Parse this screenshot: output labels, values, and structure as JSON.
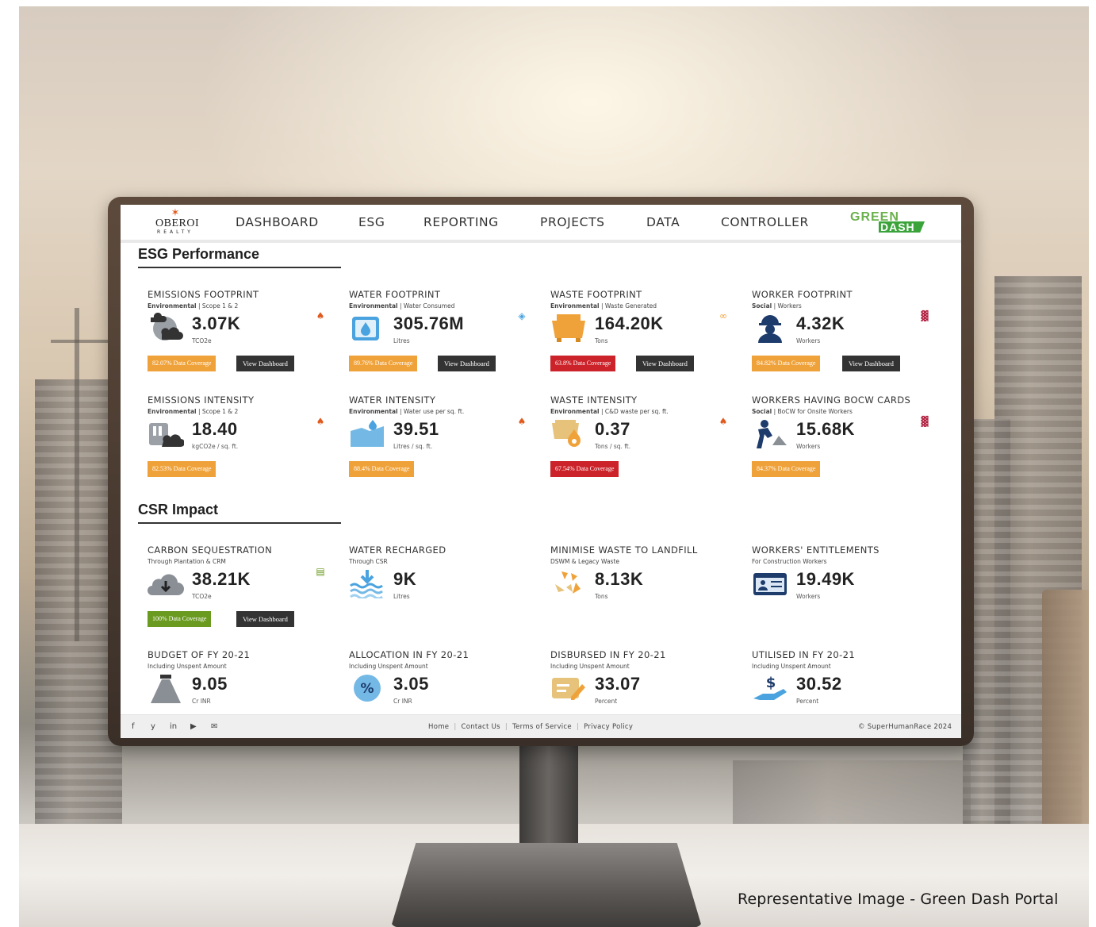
{
  "nav": {
    "logo_top": "OBEROI",
    "logo_bottom": "REALTY",
    "items": [
      "DASHBOARD",
      "ESG",
      "REPORTING",
      "PROJECTS",
      "DATA",
      "CONTROLLER"
    ],
    "brand_top": "GREEN",
    "brand_bottom": "DASH"
  },
  "esg": {
    "title": "ESG Performance",
    "cards": [
      {
        "title": "EMISSIONS FOOTPRINT",
        "tag": "Environmental",
        "sub": "Scope 1 & 2",
        "value": "3.07K",
        "unit": "TCO2e",
        "coverage": "82.07% Data Coverage",
        "coverage_color": "#f0a23a",
        "button": "View Dashboard",
        "icon": "cloud-emissions-icon"
      },
      {
        "title": "WATER FOOTPRINT",
        "tag": "Environmental",
        "sub": "Water Consumed",
        "value": "305.76M",
        "unit": "Litres",
        "coverage": "89.76% Data Coverage",
        "coverage_color": "#f0a23a",
        "button": "View Dashboard",
        "icon": "water-tank-icon"
      },
      {
        "title": "WASTE FOOTPRINT",
        "tag": "Environmental",
        "sub": "Waste Generated",
        "value": "164.20K",
        "unit": "Tons",
        "coverage": "63.8% Data Coverage",
        "coverage_color": "#cc2229",
        "button": "View Dashboard",
        "icon": "waste-bin-icon"
      },
      {
        "title": "WORKER FOOTPRINT",
        "tag": "Social",
        "sub": "Workers",
        "value": "4.32K",
        "unit": "Workers",
        "coverage": "84.82% Data Coverage",
        "coverage_color": "#f0a23a",
        "button": "View Dashboard",
        "icon": "worker-helmet-icon"
      },
      {
        "title": "EMISSIONS INTENSITY",
        "tag": "Environmental",
        "sub": "Scope 1 & 2",
        "value": "18.40",
        "unit": "kgCO2e / sq. ft.",
        "coverage": "82.53% Data Coverage",
        "coverage_color": "#f0a23a",
        "icon": "factory-cloud-icon"
      },
      {
        "title": "WATER INTENSITY",
        "tag": "Environmental",
        "sub": "Water use per sq. ft.",
        "value": "39.51",
        "unit": "Litres / sq. ft.",
        "coverage": "88.4% Data Coverage",
        "coverage_color": "#f0a23a",
        "icon": "water-drop-icon"
      },
      {
        "title": "WASTE INTENSITY",
        "tag": "Environmental",
        "sub": "C&D waste per sq. ft.",
        "value": "0.37",
        "unit": "Tons / sq. ft.",
        "coverage": "67.54% Data Coverage",
        "coverage_color": "#cc2229",
        "icon": "waste-fire-icon"
      },
      {
        "title": "WORKERS HAVING BOCW CARDS",
        "tag": "Social",
        "sub": "BoCW for Onsite Workers",
        "value": "15.68K",
        "unit": "Workers",
        "coverage": "84.37% Data Coverage",
        "coverage_color": "#f0a23a",
        "icon": "construction-worker-icon"
      }
    ]
  },
  "csr": {
    "title": "CSR Impact",
    "cards": [
      {
        "title": "CARBON SEQUESTRATION",
        "sub": "Through Plantation & CRM",
        "value": "38.21K",
        "unit": "TCO2e",
        "coverage": "100% Data Coverage",
        "coverage_color": "#6a9a1f",
        "button": "View Dashboard",
        "icon": "cloud-download-icon"
      },
      {
        "title": "WATER RECHARGED",
        "sub": "Through CSR",
        "value": "9K",
        "unit": "Litres",
        "icon": "water-recharge-icon"
      },
      {
        "title": "MINIMISE WASTE TO LANDFILL",
        "sub": "DSWM & Legacy Waste",
        "value": "8.13K",
        "unit": "Tons",
        "icon": "recycle-icon"
      },
      {
        "title": "WORKERS' ENTITLEMENTS",
        "sub": "For Construction Workers",
        "value": "19.49K",
        "unit": "Workers",
        "icon": "id-card-icon"
      },
      {
        "title": "BUDGET OF FY 20-21",
        "sub": "Including Unspent Amount",
        "value": "9.05",
        "unit": "Cr INR",
        "icon": "money-bag-icon"
      },
      {
        "title": "ALLOCATION IN FY 20-21",
        "sub": "Including Unspent Amount",
        "value": "3.05",
        "unit": "Cr INR",
        "icon": "percent-badge-icon"
      },
      {
        "title": "DISBURSED IN FY 20-21",
        "sub": "Including Unspent Amount",
        "value": "33.07",
        "unit": "Percent",
        "icon": "envelope-pen-icon"
      },
      {
        "title": "UTILISED IN FY 20-21",
        "sub": "Including Unspent Amount",
        "value": "30.52",
        "unit": "Percent",
        "icon": "dollar-hand-icon"
      }
    ]
  },
  "footer": {
    "social": [
      "f",
      "y",
      "in",
      "▶",
      "✉"
    ],
    "links": [
      "Home",
      "Contact Us",
      "Terms of Service",
      "Privacy Policy"
    ],
    "copyright": "© SuperHumanRace 2024"
  },
  "caption": "Representative Image - Green Dash Portal",
  "colors": {
    "orange": "#f0a23a",
    "red": "#cc2229",
    "green": "#6a9a1f",
    "dark_button": "#333333"
  }
}
